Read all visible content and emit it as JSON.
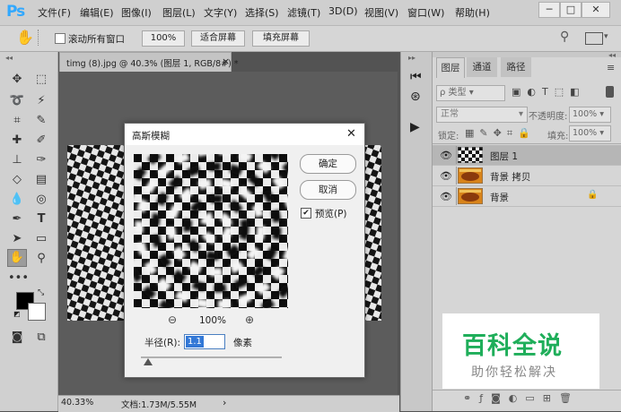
{
  "app": {
    "logo": "Ps"
  },
  "menu": [
    "文件(F)",
    "编辑(E)",
    "图像(I)",
    "图层(L)",
    "文字(Y)",
    "选择(S)",
    "滤镜(T)",
    "3D(D)",
    "视图(V)",
    "窗口(W)",
    "帮助(H)"
  ],
  "window_controls": {
    "minimize": "─",
    "maximize": "□",
    "close": "✕"
  },
  "options": {
    "scroll_all_label": "滚动所有窗口",
    "zoom_100": "100%",
    "fit_screen": "适合屏幕",
    "fill_screen": "填充屏幕"
  },
  "document": {
    "tab_title": "timg (8).jpg @ 40.3% (图层 1, RGB/8#) *",
    "tab_close": "×",
    "zoom": "40.33%",
    "status": "文档:1.73M/5.55M",
    "status_arrow": "›"
  },
  "dialog": {
    "title": "高斯模糊",
    "ok": "确定",
    "cancel": "取消",
    "preview_label": "预览(P)",
    "preview_checked": true,
    "zoom": "100%",
    "radius_label": "半径(R):",
    "radius_value": "1.1",
    "radius_unit": "像素",
    "radius_slider_fraction": 0.05
  },
  "layers_panel": {
    "tabs": [
      "图层",
      "通道",
      "路径"
    ],
    "filter_label": "ρ 类型",
    "blend_mode": "正常",
    "opacity_label": "不透明度:",
    "opacity_value": "100%",
    "lock_label": "锁定:",
    "fill_label": "填充:",
    "fill_value": "100%",
    "layers": [
      {
        "name": "图层 1",
        "selected": true,
        "locked": false,
        "thumb": "checker"
      },
      {
        "name": "背景 拷贝",
        "selected": false,
        "locked": false,
        "thumb": "photo"
      },
      {
        "name": "背景",
        "selected": false,
        "locked": true,
        "thumb": "photo"
      }
    ]
  },
  "watermark": {
    "title": "百科全说",
    "subtitle": "助你轻松解决"
  },
  "colors": {
    "accent": "#31a8ff",
    "watermark_green": "#1fae5a",
    "selected_layer": "#b6b6b6"
  }
}
